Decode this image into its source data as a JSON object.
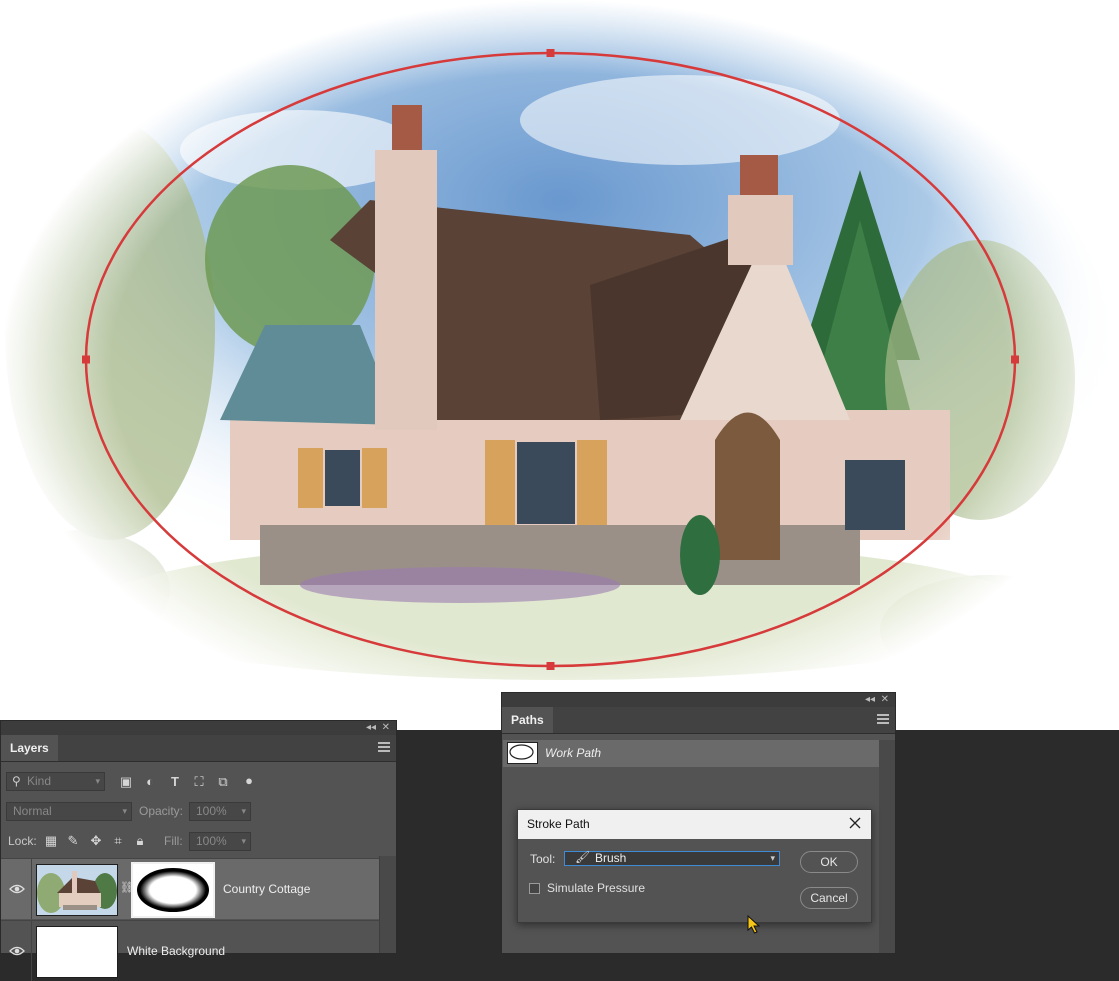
{
  "canvas": {
    "image_content": "Watercolor illustration of a country cottage with stone base, steep shingled roof, chimneys and surrounding trees",
    "path_color": "#d63a3a"
  },
  "layers_panel": {
    "title": "Layers",
    "filter_kind": "Kind",
    "blend_mode": "Normal",
    "opacity_label": "Opacity:",
    "opacity_value": "100%",
    "lock_label": "Lock:",
    "fill_label": "Fill:",
    "fill_value": "100%",
    "filter_icons": [
      "image-filter-icon",
      "adjustment-filter-icon",
      "type-filter-icon",
      "shape-filter-icon",
      "smart-object-filter-icon",
      "filter-toggle-icon"
    ],
    "lock_icons": [
      "lock-transparent-icon",
      "lock-paint-icon",
      "lock-position-icon",
      "lock-artboard-icon",
      "lock-all-icon"
    ],
    "layers": [
      {
        "name": "Country Cottage",
        "visible": true,
        "selected": true,
        "has_mask": true
      },
      {
        "name": "White Background",
        "visible": true,
        "selected": false,
        "has_mask": false
      }
    ]
  },
  "paths_panel": {
    "title": "Paths",
    "paths": [
      {
        "name": "Work Path"
      }
    ]
  },
  "stroke_dialog": {
    "title": "Stroke Path",
    "tool_label": "Tool:",
    "tool_value": "Brush",
    "simulate_pressure_label": "Simulate Pressure",
    "simulate_pressure_checked": false,
    "ok_label": "OK",
    "cancel_label": "Cancel"
  }
}
